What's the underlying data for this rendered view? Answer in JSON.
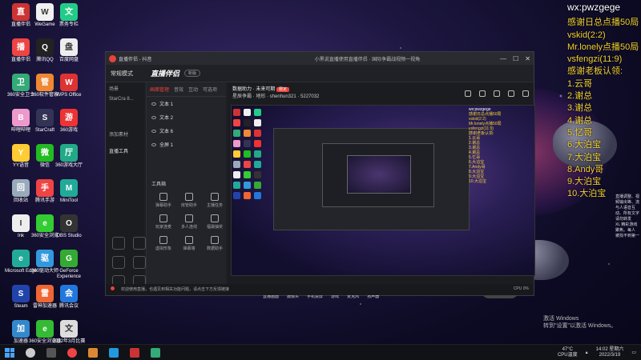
{
  "overlay": {
    "title": "wx:pwzgege",
    "lines": [
      "感谢日总点播50局",
      "vskid(2:2)",
      "Mr.lonely点播50局",
      "vsfengzi(11:9)",
      "感谢老板认领:",
      "1.云哥",
      "2.谢总",
      "3.谢总",
      "4.谢总",
      "5.忆哥",
      "6.大泊宝",
      "7.大泊宝",
      "8.Andy哥",
      "9.大泊宝",
      "10.大泊宝"
    ]
  },
  "desktop": {
    "icons": [
      {
        "label": "直播伴侣",
        "color": "#c33",
        "glyph": "直"
      },
      {
        "label": "WeGame",
        "color": "#f0f0f0",
        "glyph": "W"
      },
      {
        "label": "票务专栏",
        "color": "#2c8",
        "glyph": "文"
      },
      {
        "label": "直播伴侣",
        "color": "#e44",
        "glyph": "播"
      },
      {
        "label": "腾讯QQ",
        "color": "#222",
        "glyph": "Q"
      },
      {
        "label": "百度网盘",
        "color": "#eee",
        "glyph": "盘"
      },
      {
        "label": "360安全卫士",
        "color": "#3a7",
        "glyph": "卫"
      },
      {
        "label": "360软件管家",
        "color": "#e83",
        "glyph": "管"
      },
      {
        "label": "WPS Office",
        "color": "#d33",
        "glyph": "W"
      },
      {
        "label": "哔哩哔哩",
        "color": "#e9c",
        "glyph": "B"
      },
      {
        "label": "StarCraft",
        "color": "#335",
        "glyph": "S"
      },
      {
        "label": "360游戏",
        "color": "#e33",
        "glyph": "游"
      },
      {
        "label": "YY语音",
        "color": "#fc3",
        "glyph": "Y"
      },
      {
        "label": "微信",
        "color": "#2b2",
        "glyph": "微"
      },
      {
        "label": "360游戏大厅",
        "color": "#2a8",
        "glyph": "厅"
      },
      {
        "label": "回收站",
        "color": "#9ab",
        "glyph": "回"
      },
      {
        "label": "腾讯手游",
        "color": "#e44",
        "glyph": "手"
      },
      {
        "label": "MiniTool",
        "color": "#2a9",
        "glyph": "M"
      },
      {
        "label": "Ink",
        "color": "#eee",
        "glyph": "I"
      },
      {
        "label": "360安全浏览",
        "color": "#3c3",
        "glyph": "e"
      },
      {
        "label": "OBS Studio",
        "color": "#333",
        "glyph": "O"
      },
      {
        "label": "Microsoft Edge",
        "color": "#2a9",
        "glyph": "e"
      },
      {
        "label": "360驱动大师",
        "color": "#39d",
        "glyph": "驱"
      },
      {
        "label": "GeForce Experience",
        "color": "#3a3",
        "glyph": "G"
      },
      {
        "label": "Steam",
        "color": "#24a",
        "glyph": "S"
      },
      {
        "label": "雷神加速器",
        "color": "#e63",
        "glyph": "雷"
      },
      {
        "label": "腾讯会议",
        "color": "#27d",
        "glyph": "会"
      },
      {
        "label": "加速器",
        "color": "#38c",
        "glyph": "加"
      },
      {
        "label": "360安全浏览器",
        "color": "#3b3",
        "glyph": "e"
      },
      {
        "label": "2022年3月比赛",
        "color": "#ddd",
        "glyph": "文"
      }
    ]
  },
  "window": {
    "title": "直播伴侣 - 抖音",
    "center_text": "小黑说直播使用直播伴侣 · 国际争霸战视频一视角",
    "brand": "直播伴侣",
    "brand_tag": "新版",
    "mode": "常规模式",
    "sidebar": [
      "场景",
      "StarCra 8..."
    ],
    "sidebar_add": "添加素材",
    "sidebar_section": "直播工具",
    "panel_tabs": [
      "画面管理",
      "音效",
      "互动",
      "可选项"
    ],
    "sources": [
      "文本 1",
      "文本 2",
      "文本 6",
      "全屏 1"
    ],
    "tools_label": "工具箱",
    "tools": [
      "弹幕助手",
      "房管助手",
      "主播任务",
      "玩家连麦",
      "多人连线",
      "福袋抽奖",
      "虚拟形象",
      "弹幕墙",
      "数据助手"
    ],
    "stage_title": "数据助力 · 未来可期",
    "stage_badge": "限定",
    "stage_meta": "星辰争霸 · 地形 · shenhun321 · 5227032",
    "mini_overlay": {
      "head": "wx:pwzgege",
      "lines": [
        "感谢日总点播50局",
        "vskid(2:2)",
        "Mr.lonely点播50局",
        "vsfengzi(11:9)",
        "感谢老板认领:",
        "1.云哥",
        "2.谢总",
        "3.谢总",
        "4.谢总",
        "5.忆哥",
        "6.大泊宝",
        "7.Andy哥",
        "8.大泊宝",
        "9.大泊宝",
        "10.大泊宝"
      ]
    },
    "right_col": [
      "直播调整、视",
      "频输出等、流",
      "与人语音互",
      "动、所有文字",
      "请勿转发",
      "XL 精彩游戏",
      "聚焦。每人",
      "被找不到第一"
    ],
    "controls": [
      "直播画面",
      "摄像头",
      "手机投屏",
      "游戏",
      "麦克风",
      "扬声器"
    ],
    "go_live": "开始直播",
    "status_left": "欢迎使用直播，也遇见到相关功能问题，请点击下方反馈链接",
    "status_right": "CPU 0%"
  },
  "taskbar": {
    "temp": "47°C",
    "temp_label": "CPU温度",
    "time": "14:02 星期六",
    "date": "2022/3/19"
  },
  "activation": {
    "line1": "激活 Windows",
    "line2": "转到\"设置\"以激活 Windows。"
  }
}
